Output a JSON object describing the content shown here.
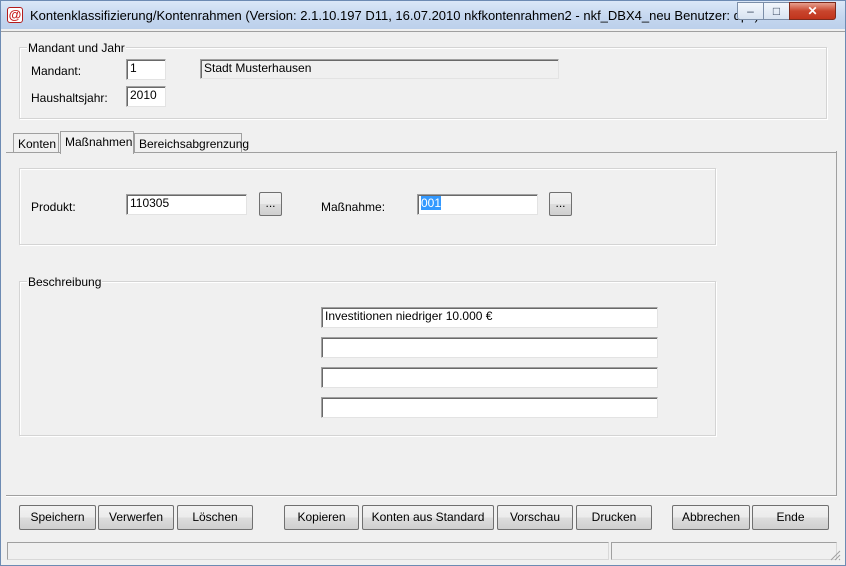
{
  "window": {
    "title": "Kontenklassifizierung/Kontenrahmen (Version: 2.1.10.197 D11, 16.07.2010 nkfkontenrahmen2 - nkf_DBX4_neu  Benutzer: dpc)",
    "app_icon": "@",
    "minimize_glyph": "–",
    "maximize_glyph": "□",
    "close_glyph": "✕"
  },
  "mandant_group": {
    "legend": "Mandant und Jahr",
    "mandant_label": "Mandant:",
    "mandant_value": "1",
    "mandant_name": "Stadt Musterhausen",
    "year_label": "Haushaltsjahr:",
    "year_value": "2010"
  },
  "tabs": [
    {
      "label": "Konten"
    },
    {
      "label": "Maßnahmen"
    },
    {
      "label": "Bereichsabgrenzung"
    }
  ],
  "massnahme_panel": {
    "produkt_label": "Produkt:",
    "produkt_value": "110305",
    "produkt_browse": "...",
    "massnahme_label": "Maßnahme:",
    "massnahme_value": "001",
    "massnahme_browse": "..."
  },
  "beschreibung": {
    "legend": "Beschreibung",
    "lines": [
      "Investitionen niedriger 10.000 €",
      "",
      "",
      ""
    ]
  },
  "buttons": {
    "speichern": "Speichern",
    "verwerfen": "Verwerfen",
    "loeschen": "Löschen",
    "kopieren": "Kopieren",
    "konten_aus_standard": "Konten aus Standard",
    "vorschau": "Vorschau",
    "drucken": "Drucken",
    "abbrechen": "Abbrechen",
    "ende": "Ende"
  }
}
